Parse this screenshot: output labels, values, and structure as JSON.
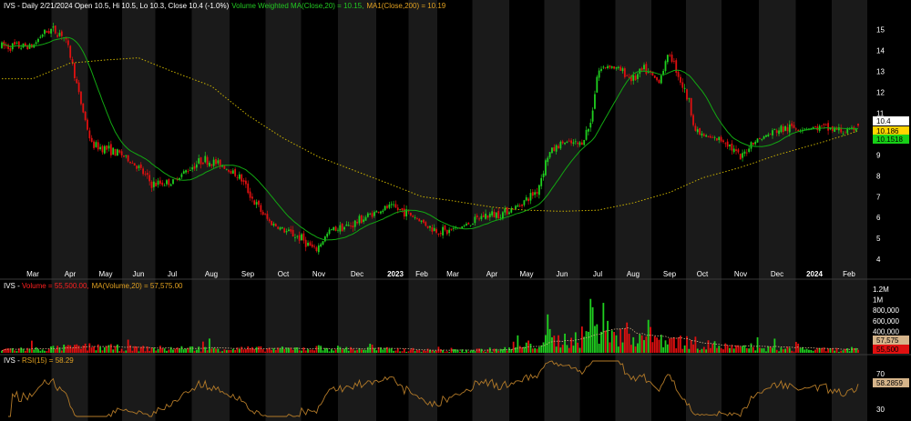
{
  "chart_data": [
    {
      "type": "candlestick",
      "symbol": "IVS",
      "title": {
        "prefix": "IVS - Daily 2/21/2024 Open 10.5, Hi 10.5, Lo 10.3, Close 10.4 (-1.0%)",
        "ma20": "Volume Weighted MA(Close,20) = 10.15,",
        "ma200": "MA1(Close,200) = 10.19"
      },
      "x_labels": [
        "Mar",
        "Apr",
        "May",
        "Jun",
        "Jul",
        "Aug",
        "Sep",
        "Oct",
        "Nov",
        "Dec",
        "2023",
        "Feb",
        "Mar",
        "Apr",
        "May",
        "Jun",
        "Jul",
        "Aug",
        "Sep",
        "Oct",
        "Nov",
        "Dec",
        "2024",
        "Feb"
      ],
      "y_ticks": [
        4,
        5,
        6,
        7,
        8,
        9,
        10,
        11,
        12,
        13,
        14,
        15
      ],
      "ylim": [
        3.7,
        15.9
      ],
      "last_values": {
        "close": "10.4",
        "ma200": "10.186",
        "ma20": "10.1518"
      },
      "price_anchors": [
        {
          "m": 0.0,
          "p": 14.2
        },
        {
          "m": 0.25,
          "p": 14.8
        },
        {
          "m": 0.5,
          "p": 15.0
        },
        {
          "m": 0.8,
          "p": 14.8
        },
        {
          "m": 1.0,
          "p": 13.8
        },
        {
          "m": 1.3,
          "p": 11.5
        },
        {
          "m": 1.6,
          "p": 9.5
        },
        {
          "m": 2.0,
          "p": 9.3
        },
        {
          "m": 2.5,
          "p": 9.0
        },
        {
          "m": 3.0,
          "p": 8.4
        },
        {
          "m": 3.4,
          "p": 7.6
        },
        {
          "m": 4.0,
          "p": 7.7
        },
        {
          "m": 4.4,
          "p": 8.3
        },
        {
          "m": 4.8,
          "p": 8.8
        },
        {
          "m": 5.3,
          "p": 8.5
        },
        {
          "m": 5.8,
          "p": 7.9
        },
        {
          "m": 6.2,
          "p": 6.7
        },
        {
          "m": 6.6,
          "p": 5.8
        },
        {
          "m": 7.0,
          "p": 5.4
        },
        {
          "m": 7.5,
          "p": 5.0
        },
        {
          "m": 7.9,
          "p": 4.4
        },
        {
          "m": 8.3,
          "p": 5.4
        },
        {
          "m": 8.8,
          "p": 5.6
        },
        {
          "m": 9.3,
          "p": 6.1
        },
        {
          "m": 9.8,
          "p": 6.5
        },
        {
          "m": 10.3,
          "p": 6.3
        },
        {
          "m": 10.8,
          "p": 6.0
        },
        {
          "m": 11.3,
          "p": 5.5
        },
        {
          "m": 11.8,
          "p": 5.3
        },
        {
          "m": 12.3,
          "p": 5.6
        },
        {
          "m": 12.8,
          "p": 6.1
        },
        {
          "m": 13.3,
          "p": 6.2
        },
        {
          "m": 13.8,
          "p": 6.6
        },
        {
          "m": 14.3,
          "p": 7.3
        },
        {
          "m": 14.6,
          "p": 9.0
        },
        {
          "m": 15.0,
          "p": 9.6
        },
        {
          "m": 15.5,
          "p": 9.5
        },
        {
          "m": 15.8,
          "p": 10.5
        },
        {
          "m": 16.0,
          "p": 13.0
        },
        {
          "m": 16.3,
          "p": 13.3
        },
        {
          "m": 16.7,
          "p": 13.0
        },
        {
          "m": 17.0,
          "p": 12.6
        },
        {
          "m": 17.3,
          "p": 13.1
        },
        {
          "m": 17.7,
          "p": 12.5
        },
        {
          "m": 18.0,
          "p": 13.9
        },
        {
          "m": 18.3,
          "p": 12.7
        },
        {
          "m": 18.6,
          "p": 11.5
        },
        {
          "m": 18.8,
          "p": 10.1
        },
        {
          "m": 19.2,
          "p": 9.8
        },
        {
          "m": 19.6,
          "p": 9.7
        },
        {
          "m": 20.0,
          "p": 8.8
        },
        {
          "m": 20.3,
          "p": 9.6
        },
        {
          "m": 20.7,
          "p": 9.9
        },
        {
          "m": 21.0,
          "p": 10.2
        },
        {
          "m": 21.4,
          "p": 10.3
        },
        {
          "m": 21.8,
          "p": 10.3
        },
        {
          "m": 22.2,
          "p": 10.3
        },
        {
          "m": 22.6,
          "p": 10.2
        },
        {
          "m": 23.0,
          "p": 10.1
        },
        {
          "m": 23.3,
          "p": 10.4
        }
      ],
      "ma200_anchors": [
        {
          "m": 0.0,
          "p": 12.65
        },
        {
          "m": 1.0,
          "p": 13.4
        },
        {
          "m": 2.0,
          "p": 13.55
        },
        {
          "m": 3.0,
          "p": 13.65
        },
        {
          "m": 4.0,
          "p": 13.0
        },
        {
          "m": 5.0,
          "p": 12.3
        },
        {
          "m": 6.0,
          "p": 10.9
        },
        {
          "m": 7.0,
          "p": 9.8
        },
        {
          "m": 8.0,
          "p": 8.9
        },
        {
          "m": 9.0,
          "p": 8.2
        },
        {
          "m": 10.0,
          "p": 7.5
        },
        {
          "m": 11.0,
          "p": 7.0
        },
        {
          "m": 12.0,
          "p": 6.8
        },
        {
          "m": 13.0,
          "p": 6.5
        },
        {
          "m": 14.0,
          "p": 6.35
        },
        {
          "m": 15.0,
          "p": 6.3
        },
        {
          "m": 16.0,
          "p": 6.35
        },
        {
          "m": 17.0,
          "p": 6.7
        },
        {
          "m": 18.0,
          "p": 7.2
        },
        {
          "m": 19.0,
          "p": 7.9
        },
        {
          "m": 20.0,
          "p": 8.4
        },
        {
          "m": 21.0,
          "p": 9.0
        },
        {
          "m": 22.0,
          "p": 9.5
        },
        {
          "m": 23.0,
          "p": 10.0
        },
        {
          "m": 23.3,
          "p": 10.19
        }
      ]
    },
    {
      "type": "bar",
      "title": {
        "prefix": "IVS - ",
        "volume": "Volume = 55,500.00,",
        "ma": "MA(Volume,20) = 57,575.00"
      },
      "y_ticks": [
        "1.2M",
        "1M",
        "800,000",
        "600,000",
        "400,000"
      ],
      "tick_values": [
        1200000,
        1000000,
        800000,
        600000,
        400000
      ],
      "ylim": [
        0,
        1300000
      ],
      "last_values": {
        "ma": "57,575",
        "volume": "55,500"
      },
      "volume_profile": [
        {
          "m": 0,
          "v": 70000
        },
        {
          "m": 1.5,
          "v": 110000
        },
        {
          "m": 3,
          "v": 80000
        },
        {
          "m": 5,
          "v": 80000
        },
        {
          "m": 7,
          "v": 70000
        },
        {
          "m": 8,
          "v": 90000
        },
        {
          "m": 10,
          "v": 60000
        },
        {
          "m": 12,
          "v": 40000
        },
        {
          "m": 13.5,
          "v": 70000
        },
        {
          "m": 14.5,
          "v": 200000
        },
        {
          "m": 15.5,
          "v": 280000
        },
        {
          "m": 16,
          "v": 400000
        },
        {
          "m": 17,
          "v": 330000
        },
        {
          "m": 18,
          "v": 250000
        },
        {
          "m": 19,
          "v": 160000
        },
        {
          "m": 20,
          "v": 90000
        },
        {
          "m": 22,
          "v": 60000
        },
        {
          "m": 23.3,
          "v": 55500
        }
      ]
    },
    {
      "type": "line",
      "title": {
        "prefix": "IVS - ",
        "rsi": "RSI(15) = 58.29"
      },
      "y_ticks": [
        70,
        30
      ],
      "ylim": [
        20,
        85
      ],
      "last_value": "58.2859"
    }
  ],
  "colors": {
    "up": "#1fcf1f",
    "down": "#e01010",
    "ma20": "#12a812",
    "ma200": "#c8b000",
    "rsi": "#b37a28",
    "vol_ma": "#d5b48a",
    "text": "#ffffff",
    "band": "#1a1a1a",
    "bg": "#000000"
  }
}
